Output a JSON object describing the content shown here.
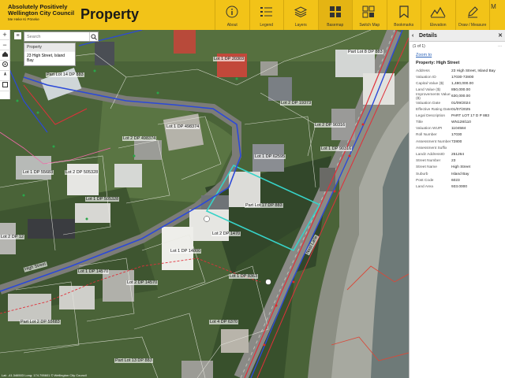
{
  "header": {
    "logo_line1": "Absolutely Positively",
    "logo_line2": "Wellington City Council",
    "logo_line3": "Me Heke Ki Pōneke",
    "app_title": "Property",
    "tools": [
      {
        "label": "About",
        "icon": "info-icon"
      },
      {
        "label": "Legend",
        "icon": "legend-icon"
      },
      {
        "label": "Layers",
        "icon": "layers-icon"
      },
      {
        "label": "Basemap",
        "icon": "basemap-icon"
      },
      {
        "label": "Switch Map",
        "icon": "switch-map-icon"
      },
      {
        "label": "Bookmarks",
        "icon": "bookmark-icon"
      },
      {
        "label": "Elevation",
        "icon": "elevation-icon"
      },
      {
        "label": "Draw / Measure",
        "icon": "draw-icon"
      }
    ],
    "more": "M"
  },
  "search": {
    "placeholder": "Search",
    "results_header": "Property",
    "result": "23 High Street, Island Bay"
  },
  "map": {
    "lot_labels": [
      "Part Lot 14 DP 883",
      "Lot 1 DP 20303",
      "Part Lot 8 DP 883",
      "Lot 1 DP 498374",
      "Lot 2 DP 498374",
      "Lot 1 DP 55683",
      "Lot 2 DP 505328",
      "Lot 1 DP 505328",
      "Lot 1 DP 62595",
      "Part Lot 17 DP 883",
      "Lot 1 DP 14800",
      "Lot 2 DP 1470",
      "Lot 1 DP 14570",
      "Lot 2 DP 14570",
      "Lot 1 DP 8363",
      "Part Lot 13 DP 883",
      "Lot 4 DP 6370",
      "Part Lot 2 DP 55683",
      "High Street",
      "Nast Lane",
      "Lot 2 DP 19373",
      "Lot 2 DP 90316",
      "Lot 1 DP 90316",
      "Lot 2 DP 12"
    ],
    "attribution": "Lat: -41.346503  Long: 174.795601  © Wellington City Council"
  },
  "details": {
    "title": "Details",
    "result_count": "(1 of 1)",
    "zoom_to": "Zoom to",
    "property_title": "Property: High Street",
    "fields": [
      {
        "k": "Address",
        "v": "23 High Street, Island Bay"
      },
      {
        "k": "Valuation ID",
        "v": "17030-72800"
      },
      {
        "k": "Capital Value ($)",
        "v": "1,480,000.00"
      },
      {
        "k": "Land Value ($)",
        "v": "850,000.00"
      },
      {
        "k": "Improvements Value ($)",
        "v": "630,000.00"
      },
      {
        "k": "Valuation Date",
        "v": "01/09/2024"
      },
      {
        "k": "Effective Rating Date",
        "v": "01/07/2025"
      },
      {
        "k": "Legal Description",
        "v": "PART LOT 17 D P 883"
      },
      {
        "k": "Title",
        "v": "WN128/110"
      },
      {
        "k": "Valuation WUPI",
        "v": "1104584"
      },
      {
        "k": "Roll Number",
        "v": "17030"
      },
      {
        "k": "Assessment Number",
        "v": "72800"
      },
      {
        "k": "Assessment Suffix",
        "v": ""
      },
      {
        "k": "Landz AddressID",
        "v": "251264"
      },
      {
        "k": "Street Number",
        "v": "23"
      },
      {
        "k": "Street Name",
        "v": "High Street"
      },
      {
        "k": "Suburb",
        "v": "Island Bay"
      },
      {
        "k": "Post Code",
        "v": "6023"
      },
      {
        "k": "Land Area",
        "v": "933.0000"
      }
    ]
  }
}
